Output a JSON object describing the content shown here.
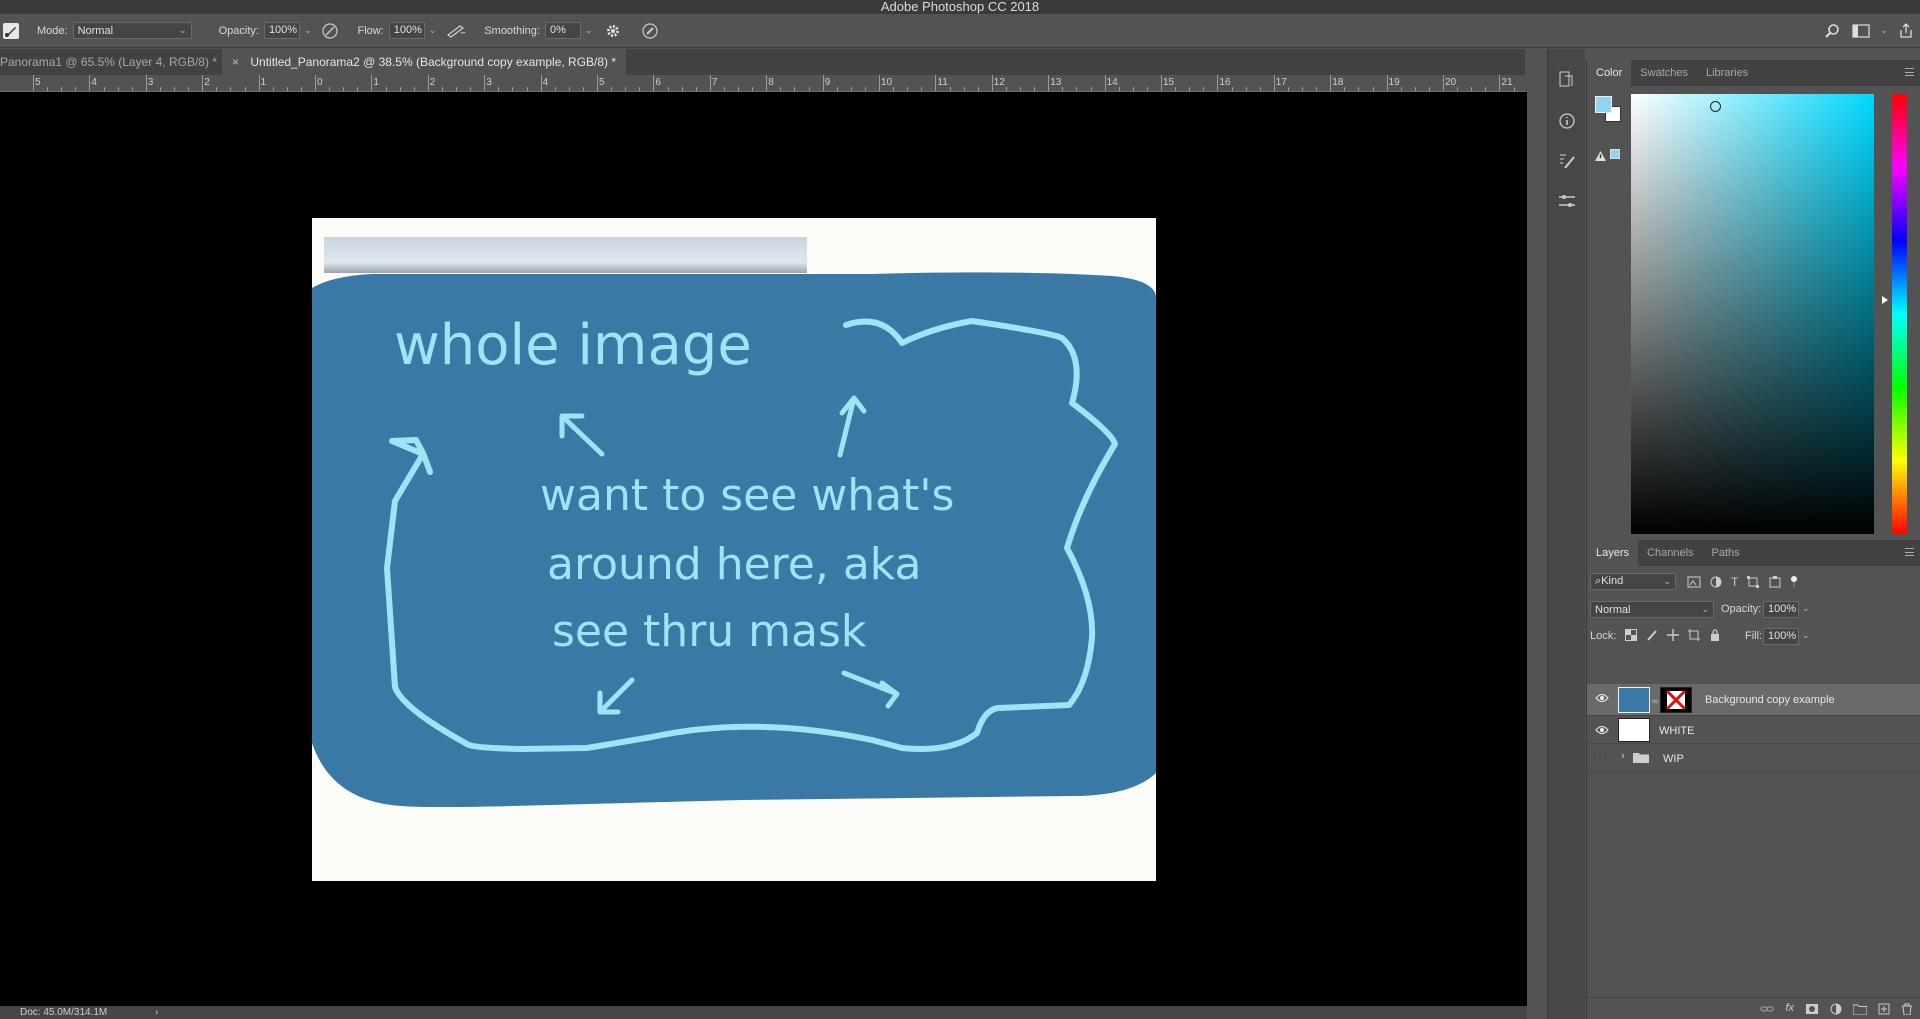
{
  "app": {
    "title": "Adobe Photoshop CC 2018"
  },
  "options_bar": {
    "mode_label": "Mode:",
    "mode_value": "Normal",
    "opacity_label": "Opacity:",
    "opacity_value": "100%",
    "flow_label": "Flow:",
    "flow_value": "100%",
    "smoothing_label": "Smoothing:",
    "smoothing_value": "0%"
  },
  "tabs": [
    {
      "label": "Panorama1 @ 65.5% (Layer 4, RGB/8) *",
      "active": false
    },
    {
      "label": "Untitled_Panorama2 @ 38.5% (Background copy example, RGB/8) *",
      "active": true,
      "close": "×"
    }
  ],
  "ruler": {
    "ticks": [
      "5",
      "4",
      "3",
      "2",
      "1",
      "0",
      "1",
      "2",
      "3",
      "4",
      "5",
      "6",
      "7",
      "8",
      "9",
      "10",
      "11",
      "12",
      "13",
      "14",
      "15",
      "16",
      "17",
      "18",
      "19",
      "20",
      "21"
    ]
  },
  "canvas": {
    "annotations": [
      "whole image",
      "want to see what's",
      "around here, aka",
      "see thru mask"
    ],
    "blob_color": "#3a79a5",
    "ink_color": "#9fe3f5"
  },
  "status_bar": {
    "doc_info": "Doc: 45.0M/314.1M",
    "arrow": "›"
  },
  "color_panel": {
    "tabs": [
      "Color",
      "Swatches",
      "Libraries"
    ],
    "foreground": "#8fd6ee",
    "background": "#ffffff"
  },
  "layers_panel": {
    "tabs": [
      "Layers",
      "Channels",
      "Paths"
    ],
    "filter_value": "Kind",
    "blend_mode": "Normal",
    "opacity_label": "Opacity:",
    "opacity_value": "100%",
    "lock_label": "Lock:",
    "fill_label": "Fill:",
    "fill_value": "100%",
    "layers": [
      {
        "name": "Background copy example",
        "visible": true,
        "selected": true
      },
      {
        "name": "WHITE",
        "visible": true,
        "selected": false
      },
      {
        "name": "WIP",
        "visible": false,
        "selected": false,
        "group": true
      }
    ]
  }
}
